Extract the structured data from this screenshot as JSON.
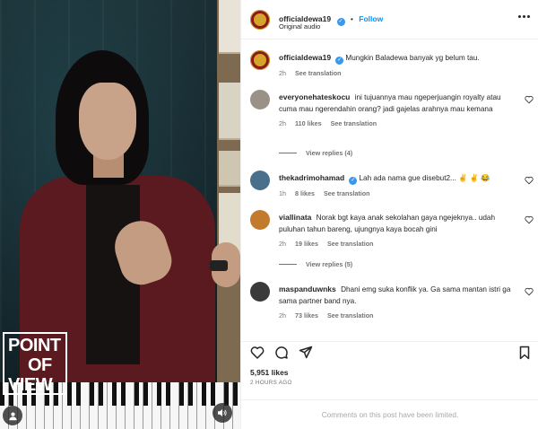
{
  "post": {
    "username": "officialdewa19",
    "follow_label": "Follow",
    "audio_label": "Original audio",
    "caption": "Mungkin Baladewa banyak yg belum tau.",
    "caption_time": "2h",
    "see_translation": "See translation"
  },
  "media": {
    "overlay_text_line1": "POINT",
    "overlay_text_line2": "OF",
    "overlay_text_line3": "VIEW",
    "user_tag_icon": "person-icon",
    "audio_icon": "speaker-icon"
  },
  "comments": [
    {
      "username": "everyonehateskocu",
      "text": "ini tujuannya mau ngeperjuangin royalty atau cuma mau ngerendahin orang? jadi gajelas arahnya mau kemana",
      "time": "2h",
      "likes": "110 likes",
      "translate": "See translation",
      "replies": "View replies (4)"
    },
    {
      "username": "thekadrimohamad",
      "verified": true,
      "text": "Lah ada nama gue disebut2... ✌️ ✌️ 😂",
      "time": "1h",
      "likes": "8 likes",
      "translate": "See translation"
    },
    {
      "username": "viallinata",
      "text": "Norak bgt kaya anak sekolahan gaya ngejeknya.. udah puluhan tahun bareng, ujungnya kaya bocah gini",
      "time": "2h",
      "likes": "19 likes",
      "translate": "See translation",
      "replies": "View replies (5)"
    },
    {
      "username": "maspanduwnks",
      "text": "Dhani emg suka konflik ya. Ga sama mantan istri ga sama partner band nya.",
      "time": "2h",
      "likes": "73 likes",
      "translate": "See translation"
    }
  ],
  "footer": {
    "likes": "5,951 likes",
    "time_ago": "2 HOURS AGO",
    "limited": "Comments on this post have been limited."
  },
  "colors": {
    "accent": "#0095f6",
    "verified": "#3897f0",
    "muted": "#737373"
  }
}
